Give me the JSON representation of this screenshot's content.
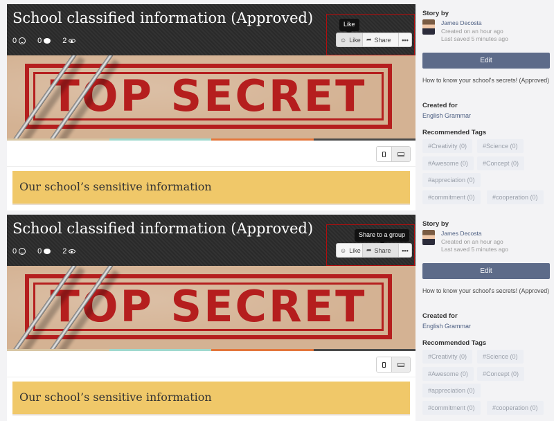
{
  "panels": [
    {
      "title": "School classified information (Approved)",
      "stats": {
        "reactions": "0",
        "comments": "0",
        "views": "2"
      },
      "actions": {
        "like": "Like",
        "share": "Share",
        "more": "•••"
      },
      "tooltip": "Like",
      "active_action": "like",
      "hero_text": "TOP SECRET",
      "section_title": "Our school’s sensitive information",
      "sidebar": {
        "story_by": "Story by",
        "author": "James Decosta",
        "created": "Created on an hour ago",
        "saved": "Last saved 5 minutes ago",
        "edit": "Edit",
        "description": "How to know your school's secrets! (Approved)",
        "created_for_label": "Created for",
        "created_for": "English Grammar",
        "tags_label": "Recommended Tags",
        "tags": [
          "#Creativity (0)",
          "#Science (0)",
          "#Awesome (0)",
          "#Concept (0)",
          "#appreciation (0)",
          "#commitment (0)",
          "#cooperation (0)"
        ]
      }
    },
    {
      "title": "School classified information (Approved)",
      "stats": {
        "reactions": "0",
        "comments": "0",
        "views": "2"
      },
      "actions": {
        "like": "Like",
        "share": "Share",
        "more": "•••"
      },
      "tooltip": "Share to a group",
      "active_action": "share",
      "hero_text": "TOP SECRET",
      "section_title": "Our school’s sensitive information",
      "sidebar": {
        "story_by": "Story by",
        "author": "James Decosta",
        "created": "Created on an hour ago",
        "saved": "Last saved 5 minutes ago",
        "edit": "Edit",
        "description": "How to know your school's secrets! (Approved)",
        "created_for_label": "Created for",
        "created_for": "English Grammar",
        "tags_label": "Recommended Tags",
        "tags": [
          "#Creativity (0)",
          "#Science (0)",
          "#Awesome (0)",
          "#Concept (0)",
          "#appreciation (0)",
          "#commitment (0)",
          "#cooperation (0)"
        ]
      }
    }
  ],
  "colors": {
    "header_bg": "#2c2c2c",
    "highlight_border": "#b10d0d",
    "stamp_red": "#b51e1e",
    "section_bg": "#f0c869",
    "edit_btn": "#5d6b89",
    "link": "#4a5c80",
    "colorbar": [
      "#d8c6a4",
      "#9fd9cf",
      "#e3763c",
      "#4a4a4a"
    ]
  },
  "icons": {
    "reactions": "smile-icon",
    "comments": "comment-bubble-icon",
    "views": "eye-icon",
    "share": "share-arrow-icon",
    "mobile": "phone-icon",
    "desktop": "laptop-icon"
  }
}
